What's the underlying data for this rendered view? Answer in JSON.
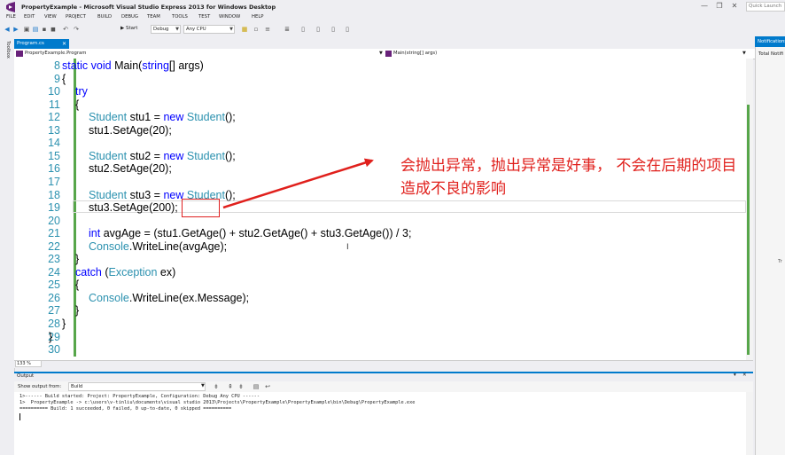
{
  "window": {
    "title": "PropertyExample - Microsoft Visual Studio Express 2013 for Windows Desktop",
    "quick_launch_placeholder": "Quick Launch",
    "minimize": "—",
    "restore": "❐",
    "close": "✕"
  },
  "menu": [
    "FILE",
    "EDIT",
    "VIEW",
    "PROJECT",
    "BUILD",
    "DEBUG",
    "TEAM",
    "TOOLS",
    "TEST",
    "WINDOW",
    "HELP"
  ],
  "toolbar": {
    "start_label": "▶ Start",
    "config": "Debug",
    "platform": "Any CPU"
  },
  "toolbox_label": "Toolbox",
  "document_tab": {
    "label": "Program.cs",
    "close": "✕"
  },
  "navbar": {
    "left": "PropertyExample.Program",
    "right": "Main(string[] args)"
  },
  "code_lines": [
    {
      "n": "8",
      "indent": 2,
      "parts": [
        {
          "t": "static void ",
          "c": "kw"
        },
        {
          "t": "Main(",
          "c": ""
        },
        {
          "t": "string",
          "c": "kw"
        },
        {
          "t": "[] args)",
          "c": ""
        }
      ]
    },
    {
      "n": "9",
      "indent": 2,
      "parts": [
        {
          "t": "{",
          "c": ""
        }
      ]
    },
    {
      "n": "10",
      "indent": 3,
      "parts": [
        {
          "t": "try",
          "c": "kw"
        }
      ]
    },
    {
      "n": "11",
      "indent": 3,
      "parts": [
        {
          "t": "{",
          "c": ""
        }
      ]
    },
    {
      "n": "12",
      "indent": 4,
      "parts": [
        {
          "t": "Student",
          "c": "ty"
        },
        {
          "t": " stu1 = ",
          "c": ""
        },
        {
          "t": "new ",
          "c": "kw"
        },
        {
          "t": "Student",
          "c": "ty"
        },
        {
          "t": "();",
          "c": ""
        }
      ]
    },
    {
      "n": "13",
      "indent": 4,
      "parts": [
        {
          "t": "stu1.SetAge(20);",
          "c": ""
        }
      ]
    },
    {
      "n": "14",
      "indent": 4,
      "parts": []
    },
    {
      "n": "15",
      "indent": 4,
      "parts": [
        {
          "t": "Student",
          "c": "ty"
        },
        {
          "t": " stu2 = ",
          "c": ""
        },
        {
          "t": "new ",
          "c": "kw"
        },
        {
          "t": "Student",
          "c": "ty"
        },
        {
          "t": "();",
          "c": ""
        }
      ]
    },
    {
      "n": "16",
      "indent": 4,
      "parts": [
        {
          "t": "stu2.SetAge(20);",
          "c": ""
        }
      ]
    },
    {
      "n": "17",
      "indent": 4,
      "parts": []
    },
    {
      "n": "18",
      "indent": 4,
      "parts": [
        {
          "t": "Student",
          "c": "ty"
        },
        {
          "t": " stu3 = ",
          "c": ""
        },
        {
          "t": "new ",
          "c": "kw"
        },
        {
          "t": "Student",
          "c": "ty"
        },
        {
          "t": "();",
          "c": ""
        }
      ]
    },
    {
      "n": "19",
      "indent": 4,
      "parts": [
        {
          "t": "stu3.SetAge(200);",
          "c": ""
        }
      ]
    },
    {
      "n": "20",
      "indent": 4,
      "parts": []
    },
    {
      "n": "21",
      "indent": 4,
      "parts": [
        {
          "t": "int ",
          "c": "kw"
        },
        {
          "t": "avgAge = (stu1.GetAge() + stu2.GetAge() + stu3.GetAge()) / 3;",
          "c": ""
        }
      ]
    },
    {
      "n": "22",
      "indent": 4,
      "parts": [
        {
          "t": "Console",
          "c": "ty"
        },
        {
          "t": ".WriteLine(avgAge);",
          "c": ""
        }
      ]
    },
    {
      "n": "23",
      "indent": 3,
      "parts": [
        {
          "t": "}",
          "c": ""
        }
      ]
    },
    {
      "n": "24",
      "indent": 3,
      "parts": [
        {
          "t": "catch ",
          "c": "kw"
        },
        {
          "t": "(",
          "c": ""
        },
        {
          "t": "Exception",
          "c": "ty"
        },
        {
          "t": " ex)",
          "c": ""
        }
      ]
    },
    {
      "n": "25",
      "indent": 3,
      "parts": [
        {
          "t": "{",
          "c": ""
        }
      ]
    },
    {
      "n": "26",
      "indent": 4,
      "parts": [
        {
          "t": "Console",
          "c": "ty"
        },
        {
          "t": ".WriteLine(ex.Message);",
          "c": ""
        }
      ]
    },
    {
      "n": "27",
      "indent": 3,
      "parts": [
        {
          "t": "}",
          "c": ""
        }
      ]
    },
    {
      "n": "28",
      "indent": 2,
      "parts": [
        {
          "t": "}",
          "c": ""
        }
      ]
    },
    {
      "n": "29",
      "indent": 1,
      "parts": [
        {
          "t": "}",
          "c": ""
        }
      ]
    },
    {
      "n": "30",
      "indent": 1,
      "parts": []
    }
  ],
  "annotation": "会抛出异常，抛出异常是好事， 不会在后期的项目\n造成不良的影响",
  "zoom": "133 %",
  "output": {
    "title": "Output",
    "show_from_label": "Show output from:",
    "source": "Build",
    "lines": [
      "1>------ Build started: Project: PropertyExample, Configuration: Debug Any CPU ------",
      "1>  PropertyExample -> c:\\users\\v-tinliu\\documents\\visual studio 2013\\Projects\\PropertyExample\\PropertyExample\\bin\\Debug\\PropertyExample.exe",
      "========== Build: 1 succeeded, 0 failed, 0 up-to-date, 0 skipped =========="
    ]
  },
  "notifications": {
    "title": "Notifications",
    "total": "Total Notifi",
    "side_text": "Tr"
  },
  "colors": {
    "accent": "#007acc",
    "annotation": "#e0201c",
    "keyword": "#0000ff",
    "type": "#2b91af",
    "change_bar": "#57a64a"
  }
}
